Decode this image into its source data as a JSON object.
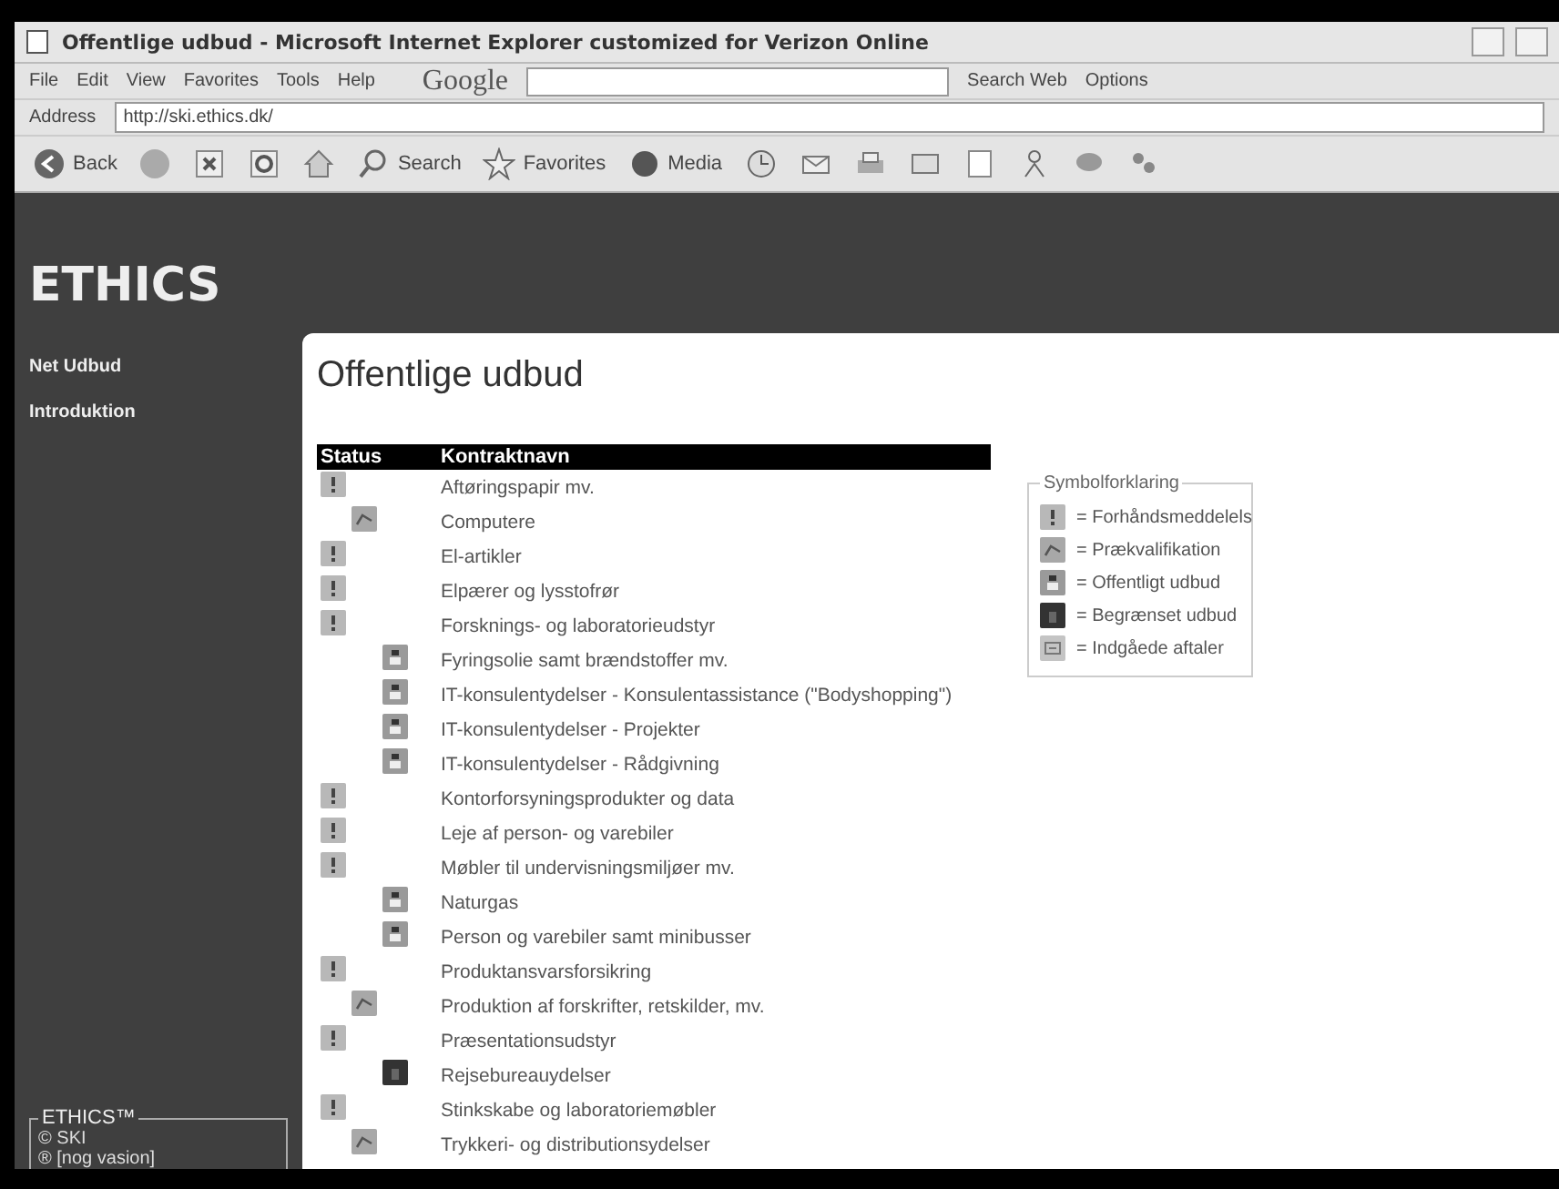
{
  "window": {
    "title": "Offentlige udbud - Microsoft Internet Explorer customized for Verizon Online"
  },
  "menu": [
    "File",
    "Edit",
    "View",
    "Favorites",
    "Tools",
    "Help"
  ],
  "google_bar": {
    "brand": "Google",
    "search_web": "Search Web",
    "options": "Options"
  },
  "address_bar": {
    "label": "Address",
    "url": "http://ski.ethics.dk/"
  },
  "toolbar": {
    "back": "Back",
    "search": "Search",
    "favorites": "Favorites",
    "media": "Media"
  },
  "sidebar": {
    "logo": "ETHICS",
    "items": [
      "Net Udbud",
      "Introduktion"
    ],
    "footer": {
      "title": "ETHICS™",
      "lines": [
        "© SKI",
        "® [nog vasion]"
      ]
    }
  },
  "page": {
    "heading": "Offentlige udbud",
    "table": {
      "columns": [
        "Status",
        "Kontraktnavn"
      ],
      "rows": [
        {
          "kind": "notice",
          "name": "Aftøringspapir mv."
        },
        {
          "kind": "prequalification",
          "name": "Computere"
        },
        {
          "kind": "notice",
          "name": "El-artikler"
        },
        {
          "kind": "notice",
          "name": "Elpærer og lysstofrør"
        },
        {
          "kind": "notice",
          "name": "Forsknings- og laboratorieudstyr"
        },
        {
          "kind": "public",
          "name": "Fyringsolie samt brændstoffer mv."
        },
        {
          "kind": "public",
          "name": "IT-konsulentydelser - Konsulentassistance (\"Bodyshopping\")"
        },
        {
          "kind": "public",
          "name": "IT-konsulentydelser - Projekter"
        },
        {
          "kind": "public",
          "name": "IT-konsulentydelser - Rådgivning"
        },
        {
          "kind": "notice",
          "name": "Kontorforsyningsprodukter og data"
        },
        {
          "kind": "notice",
          "name": "Leje af person- og varebiler"
        },
        {
          "kind": "notice",
          "name": "Møbler til undervisningsmiljøer mv."
        },
        {
          "kind": "public",
          "name": "Naturgas"
        },
        {
          "kind": "public",
          "name": "Person og varebiler samt minibusser"
        },
        {
          "kind": "notice",
          "name": "Produktansvarsforsikring"
        },
        {
          "kind": "prequalification",
          "name": "Produktion af forskrifter, retskilder, mv."
        },
        {
          "kind": "notice",
          "name": "Præsentationsudstyr"
        },
        {
          "kind": "restricted",
          "name": "Rejsebureauydelser"
        },
        {
          "kind": "notice",
          "name": "Stinkskabe og laboratoriemøbler"
        },
        {
          "kind": "prequalification",
          "name": "Trykkeri- og distributionsydelser"
        }
      ]
    },
    "legend": {
      "title": "Symbolforklaring",
      "items": [
        {
          "kind": "notice",
          "label": "= Forhåndsmeddelels"
        },
        {
          "kind": "prequalification",
          "label": "= Prækvalifikation"
        },
        {
          "kind": "public",
          "label": "= Offentligt udbud"
        },
        {
          "kind": "restricted",
          "label": "= Begrænset udbud"
        },
        {
          "kind": "agreement",
          "label": "= Indgåede aftaler"
        }
      ]
    }
  }
}
